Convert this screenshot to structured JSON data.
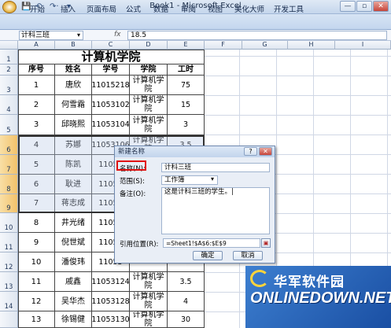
{
  "window": {
    "title": "Book1 - Microsoft Excel",
    "minimize": "—",
    "restore": "▫",
    "close": "✕"
  },
  "qat": {
    "save_icon": "💾",
    "undo": "↶·",
    "redo": "↷·",
    "dropdown": "▾"
  },
  "tabs": [
    "开始",
    "插入",
    "页面布局",
    "公式",
    "数据",
    "审阅",
    "视图",
    "美化大师",
    "开发工具"
  ],
  "formula_bar": {
    "name_box": "计科三班",
    "fx": "fx",
    "content": "18.5"
  },
  "columns": [
    "A",
    "B",
    "C",
    "D",
    "E",
    "F",
    "G",
    "H",
    "I"
  ],
  "sheet": {
    "title": "计算机学院",
    "headers": [
      "序号",
      "姓名",
      "学号",
      "学院",
      "工时"
    ],
    "rows": [
      [
        "1",
        "唐欣",
        "11015218",
        "计算机学院",
        "75"
      ],
      [
        "2",
        "何雪霜",
        "11053102",
        "计算机学院",
        "15"
      ],
      [
        "3",
        "邱晓熙",
        "11053104",
        "计算机学院",
        "3"
      ],
      [
        "4",
        "苏娜",
        "11053106",
        "计算机学院",
        "3.5"
      ],
      [
        "5",
        "陈凯",
        "11053",
        "",
        ""
      ],
      [
        "6",
        "耿进",
        "11053",
        "",
        ""
      ],
      [
        "7",
        "蒋志成",
        "11053",
        "",
        ""
      ],
      [
        "8",
        "井光绪",
        "11053",
        "",
        ""
      ],
      [
        "9",
        "倪世斌",
        "11053",
        "",
        ""
      ],
      [
        "10",
        "潘俊玮",
        "11053",
        "",
        ""
      ],
      [
        "11",
        "戚鑫",
        "11053124",
        "计算机学院",
        "3.5"
      ],
      [
        "12",
        "吴华杰",
        "11053128",
        "计算机学院",
        "4"
      ],
      [
        "13",
        "徐锡健",
        "11053130",
        "计算机学院",
        "30"
      ]
    ],
    "row_numbers": [
      "1",
      "2",
      "3",
      "4",
      "5",
      "6",
      "7",
      "8",
      "9",
      "10",
      "11",
      "12",
      "13",
      "14"
    ]
  },
  "dialog": {
    "title": "新建名称",
    "help": "?",
    "close": "✕",
    "name_label": "名称(N):",
    "name_value": "计科三班",
    "scope_label": "范围(S):",
    "scope_value": "工作簿",
    "comment_label": "备注(O):",
    "comment_value": "这是计科三班的学生。|",
    "refers_label": "引用位置(R):",
    "refers_value": "=Sheet1!$A$6:$E$9",
    "ok": "确定",
    "cancel": "取消"
  },
  "watermark": {
    "cn": "华军软件园",
    "en": "ONLINEDOWN.NET"
  },
  "colors": {
    "selection": "#f2c26a",
    "accent": "#1a4fa3",
    "highlight": "#e01010"
  }
}
